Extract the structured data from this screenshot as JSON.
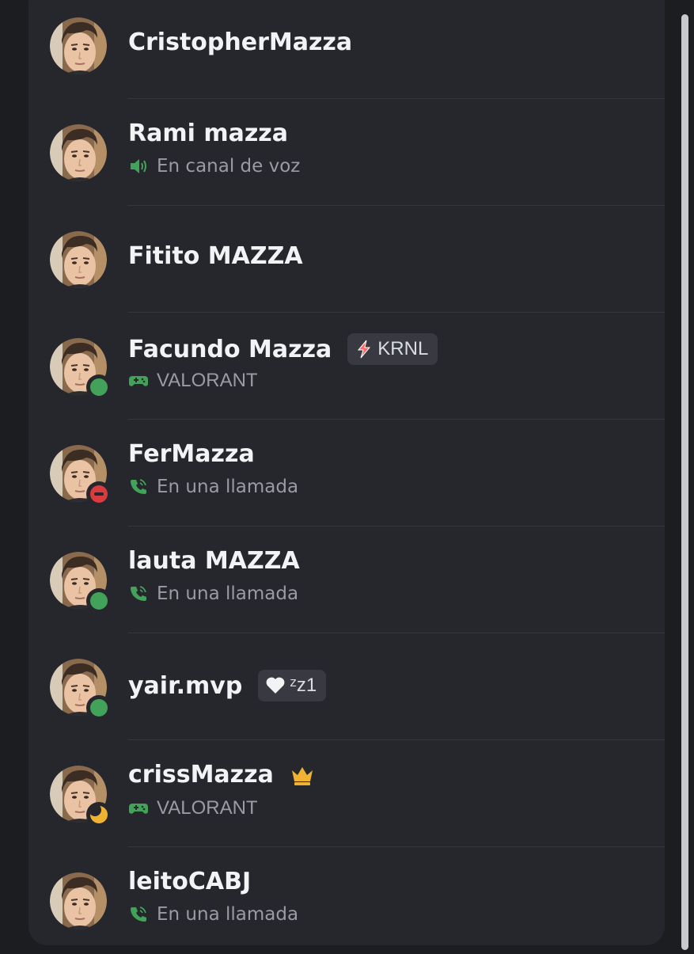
{
  "members": [
    {
      "name": "CristopherMazza",
      "status": "none",
      "activity": null,
      "tag": null
    },
    {
      "name": "Rami mazza",
      "status": "none",
      "activity": {
        "icon": "speaker-icon",
        "text": "En canal de voz"
      },
      "tag": null
    },
    {
      "name": "Fitito MAZZA",
      "status": "none",
      "activity": null,
      "tag": null
    },
    {
      "name": "Facundo Mazza",
      "status": "online",
      "activity": {
        "icon": "gamepad-icon",
        "text": "VALORANT"
      },
      "tag": {
        "icon": "lightning-icon",
        "text": "KRNL"
      }
    },
    {
      "name": "FerMazza",
      "status": "dnd",
      "activity": {
        "icon": "phone-call-icon",
        "text": "En una llamada"
      },
      "tag": null
    },
    {
      "name": "lauta MAZZA",
      "status": "online",
      "activity": {
        "icon": "phone-call-icon",
        "text": "En una llamada"
      },
      "tag": null
    },
    {
      "name": "yair.mvp",
      "status": "online",
      "activity": null,
      "tag": {
        "icon": "white-heart-icon",
        "text": "ᶻz1"
      }
    },
    {
      "name": "crissMazza",
      "status": "idle",
      "activity": {
        "icon": "gamepad-icon",
        "text": "VALORANT"
      },
      "tag": null,
      "badge": "crown-icon"
    },
    {
      "name": "leitoCABJ",
      "status": "none",
      "activity": {
        "icon": "phone-call-icon",
        "text": "En una llamada"
      },
      "tag": null
    }
  ],
  "colors": {
    "online": "#43a25a",
    "dnd": "#d83c3e",
    "idle": "#f0b232",
    "activity_icon": "#43a25a",
    "crown": "#f0b232"
  }
}
